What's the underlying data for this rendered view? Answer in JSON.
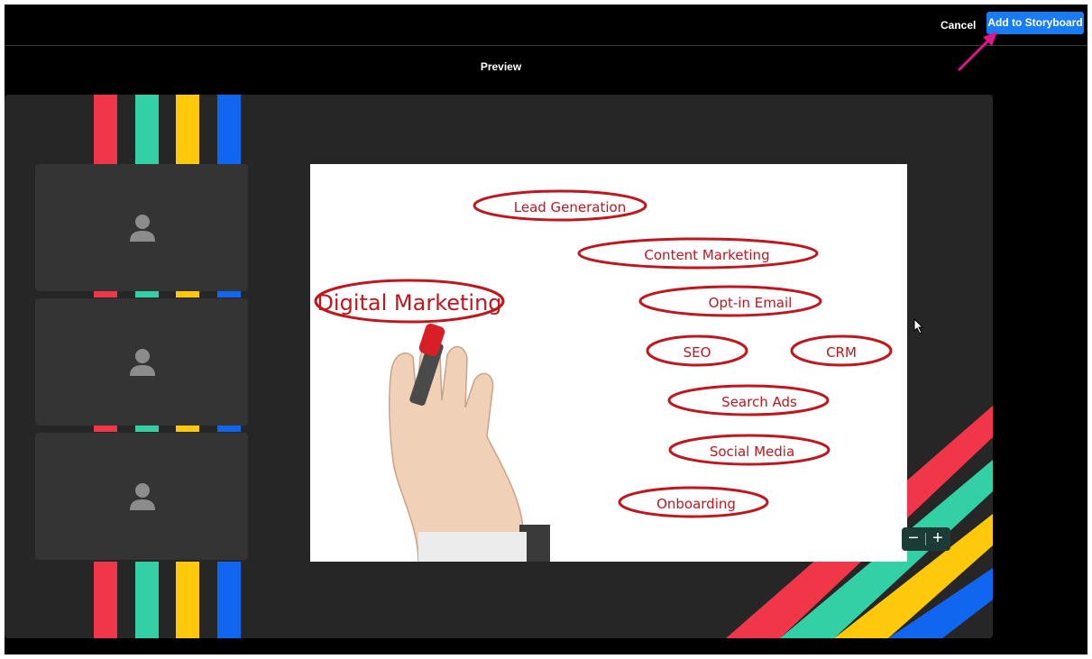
{
  "header": {
    "cancel_label": "Cancel",
    "add_label": "Add to Storyboard"
  },
  "preview": {
    "title": "Preview"
  },
  "slide": {
    "heading": "Digital Marketing",
    "tags": [
      "Lead Generation",
      "Content Marketing",
      "Opt-in Email",
      "SEO",
      "CRM",
      "Search Ads",
      "Social Media",
      "Onboarding"
    ]
  },
  "participants": [
    {
      "icon": "person-icon"
    },
    {
      "icon": "person-icon"
    },
    {
      "icon": "person-icon"
    }
  ],
  "zoom": {
    "minus": "−",
    "plus": "+"
  },
  "colors": {
    "accent": "#1a7cf5",
    "stripe_red": "#f2364a",
    "stripe_teal": "#33d0a6",
    "stripe_yellow": "#fec80b",
    "stripe_blue": "#1166f0",
    "annotation_arrow": "#e0168a",
    "ink_red": "#c0161d"
  }
}
